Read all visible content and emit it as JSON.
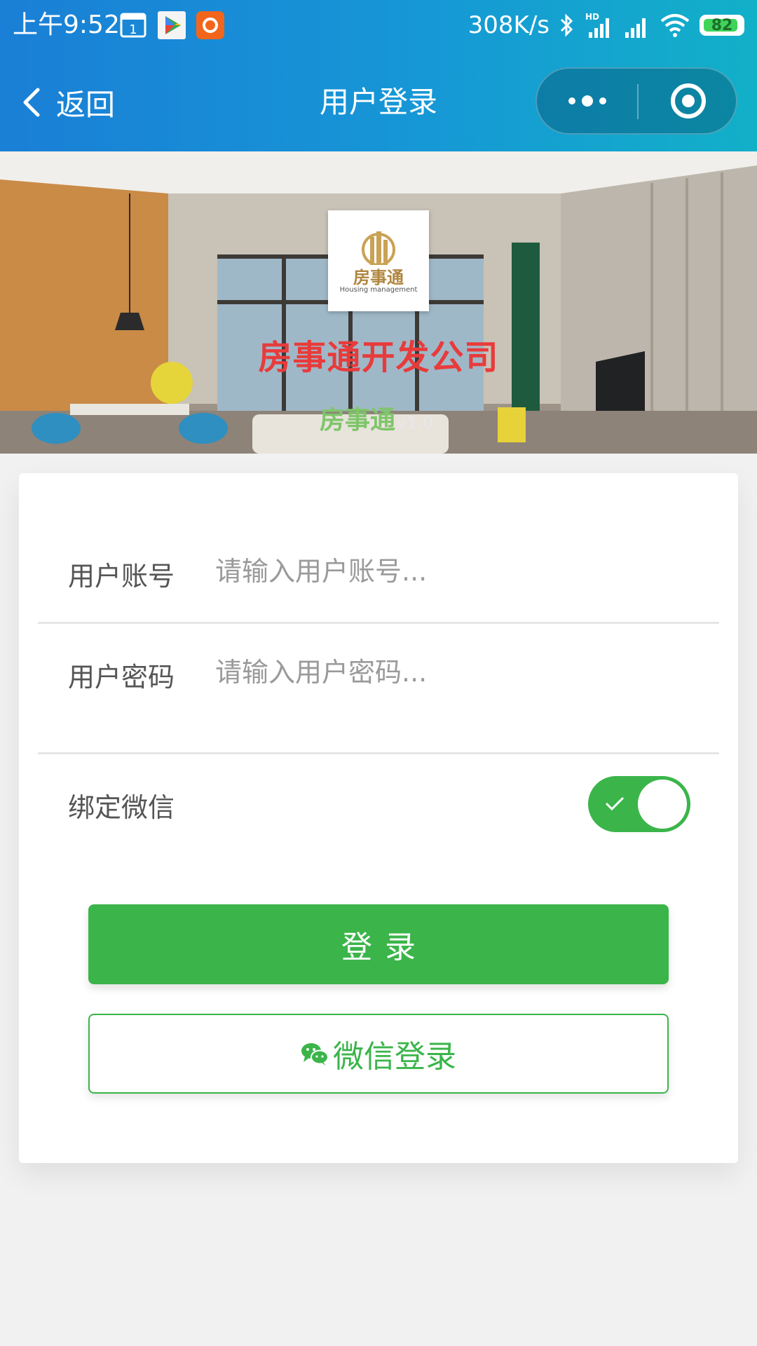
{
  "status_bar": {
    "time": "上午9:52",
    "net_speed": "308K/s",
    "battery": "82",
    "battery_level": 0.82,
    "icons": [
      "calendar-icon",
      "play-store-icon",
      "orange-app-icon",
      "bluetooth-icon",
      "hd-signal-icon",
      "signal-icon",
      "wifi-icon",
      "battery-icon"
    ]
  },
  "nav": {
    "back_label": "返回",
    "title": "用户登录"
  },
  "banner": {
    "logo_text": "房事通",
    "logo_sub": "Housing management",
    "company_name": "房事通开发公司",
    "app_name": "房事通",
    "version": "v1.0"
  },
  "form": {
    "account_label": "用户账号",
    "account_placeholder": "请输入用户账号...",
    "account_value": "",
    "password_label": "用户密码",
    "password_placeholder": "请输入用户密码...",
    "password_value": "",
    "bind_wechat_label": "绑定微信",
    "bind_wechat_on": true,
    "login_button": "登录",
    "wechat_login_button": "微信登录"
  },
  "colors": {
    "header_start": "#1a7fd6",
    "header_end": "#12b0c8",
    "accent_green": "#3bb54a",
    "company_red": "#e83b3b",
    "page_bg": "#f1f1f1"
  }
}
